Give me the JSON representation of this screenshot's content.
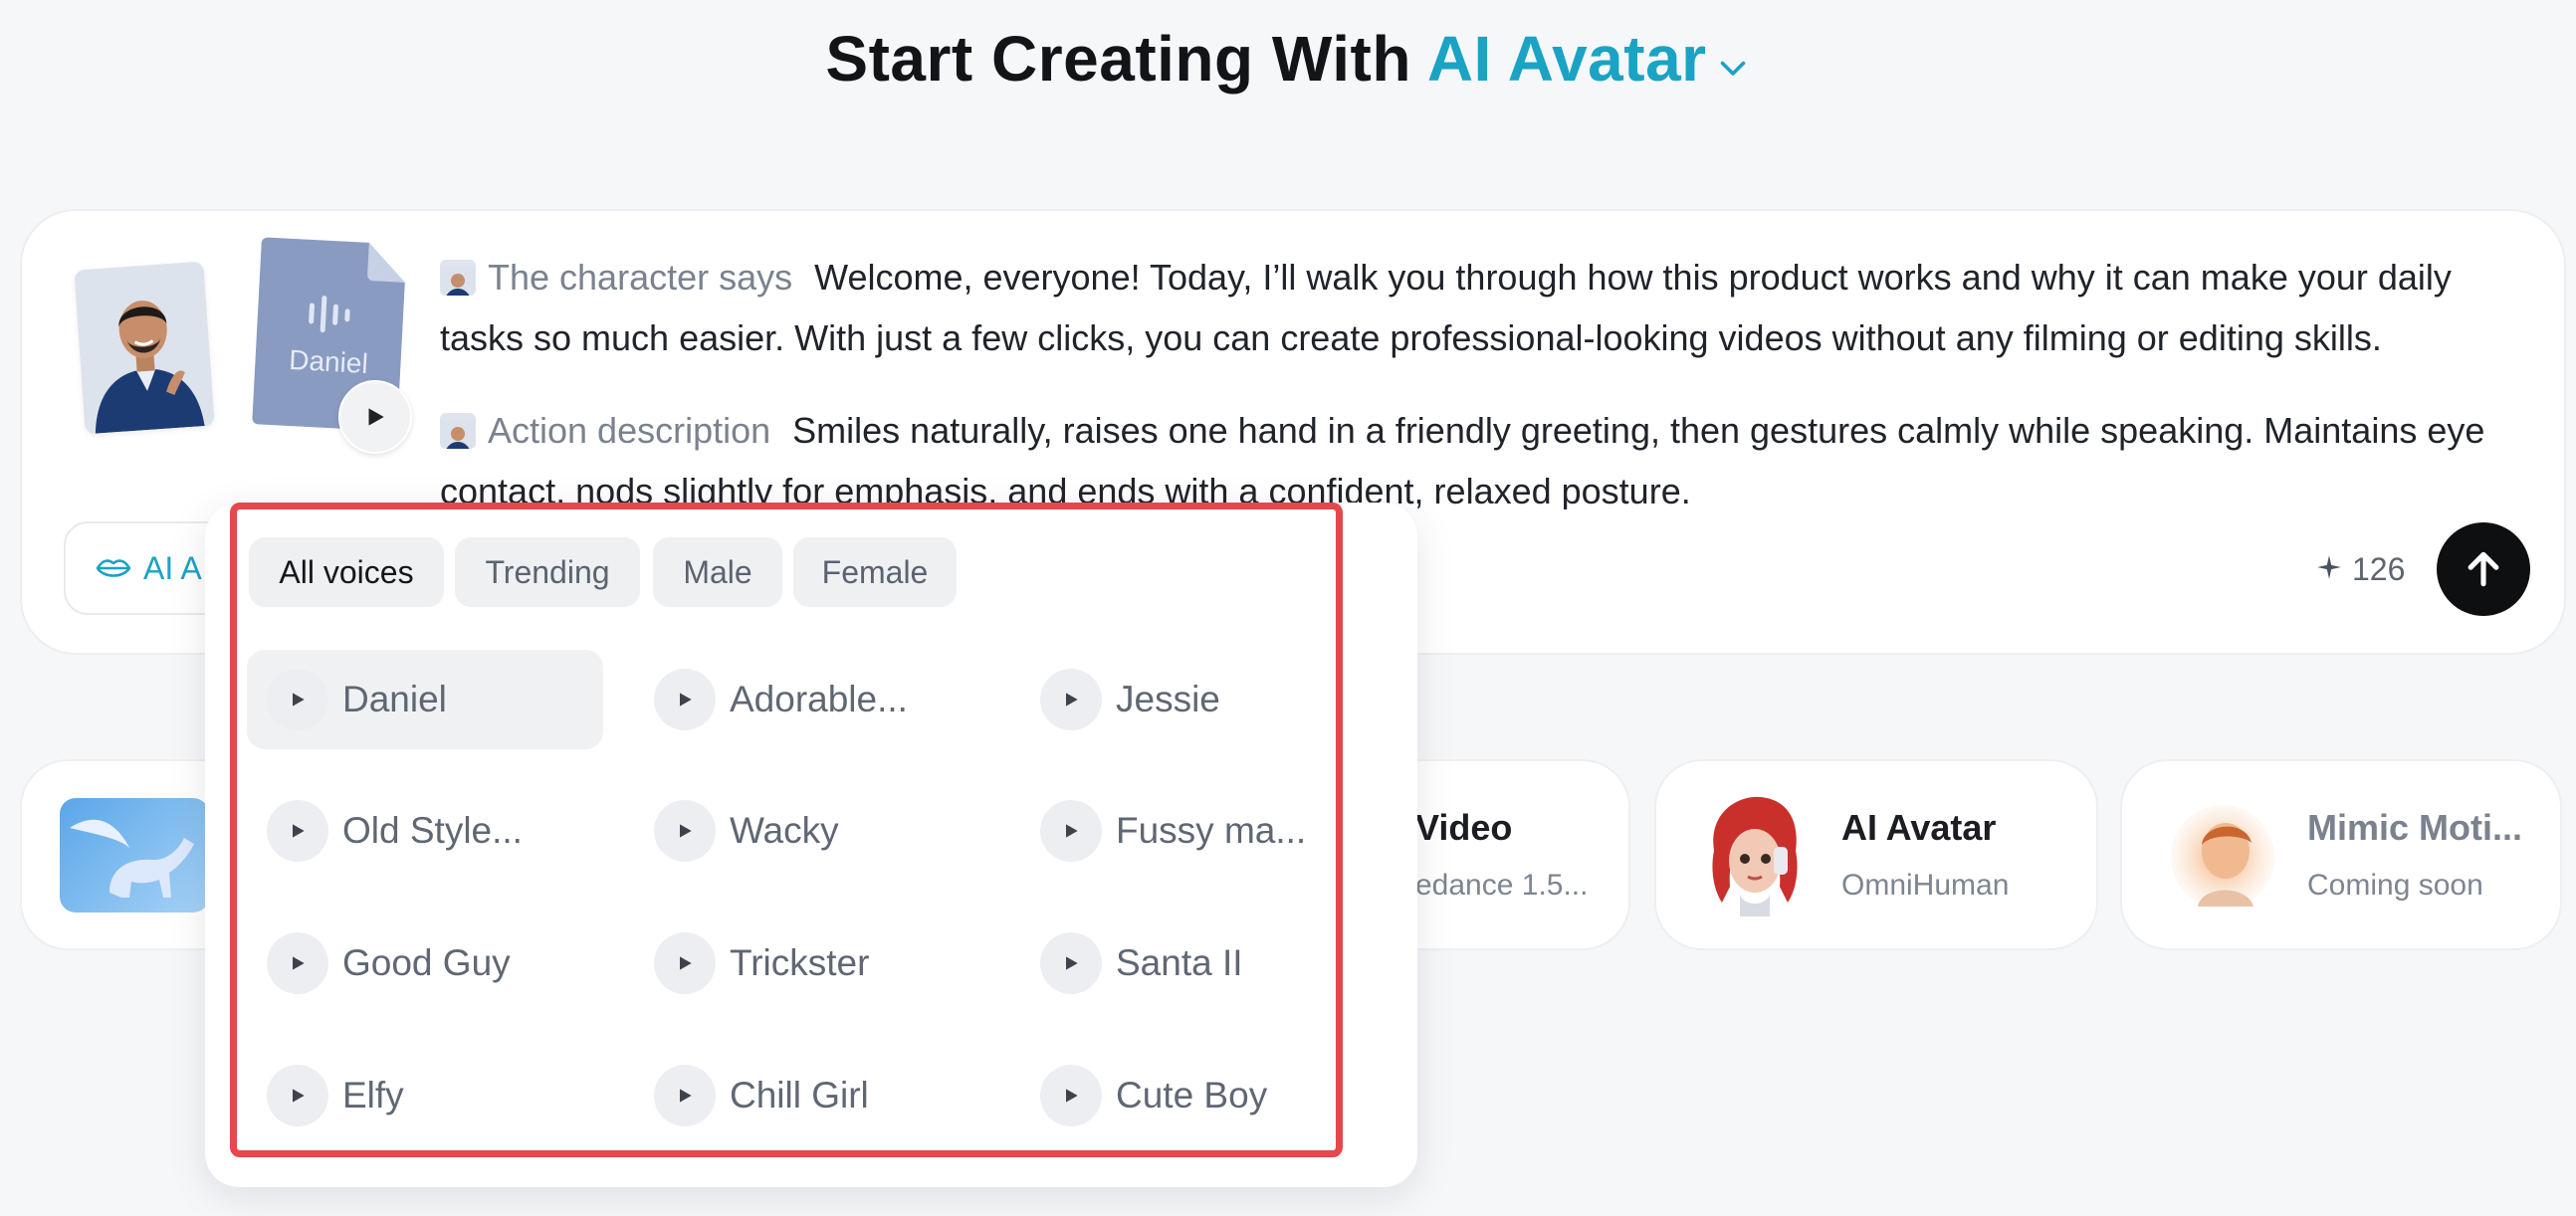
{
  "heading": {
    "prefix": "Start Creating With",
    "accent": "AI Avatar"
  },
  "composer": {
    "voice_file_label": "Daniel",
    "says_label": "The character says",
    "says_text": "Welcome, everyone! Today, I’ll walk you through how this product works and why it can make your daily tasks so much easier. With just a few clicks, you can create professional-looking videos without any filming or editing skills.",
    "action_label": "Action description",
    "action_text": "Smiles naturally, raises one hand in a friendly greeting, then gestures calmly while speaking. Maintains eye contact, nods slightly for emphasis, and ends with a confident, relaxed posture.",
    "mode_label": "AI A",
    "credits": "126"
  },
  "tools": [
    {
      "title": "",
      "subtitle": ""
    },
    {
      "title": "Video",
      "subtitle": "edance 1.5..."
    },
    {
      "title": "AI Avatar",
      "subtitle": "OmniHuman"
    },
    {
      "title": "Mimic Moti...",
      "subtitle": "Coming soon"
    }
  ],
  "voice_panel": {
    "tabs": [
      "All voices",
      "Trending",
      "Male",
      "Female"
    ],
    "voices": [
      "Daniel",
      "Adorable...",
      "Jessie",
      "Old Style...",
      "Wacky",
      "Fussy ma...",
      "Good Guy",
      "Trickster",
      "Santa II",
      "Elfy",
      "Chill Girl",
      "Cute Boy"
    ]
  },
  "colors": {
    "accent": "#1aa3c4",
    "highlight": "#e5484d",
    "send": "#0e0f11"
  }
}
